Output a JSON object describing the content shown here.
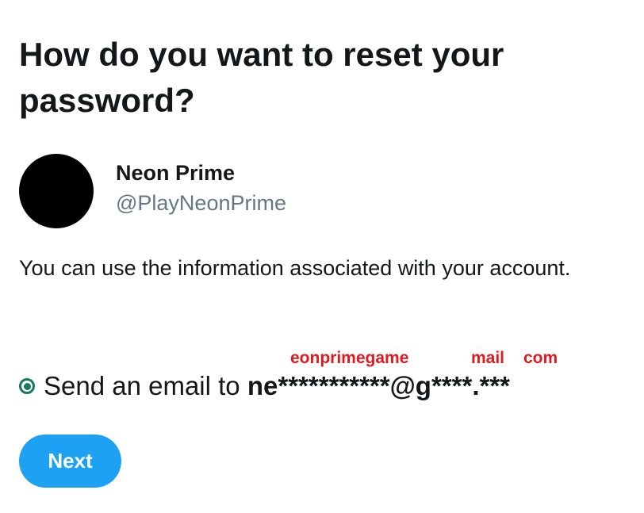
{
  "page": {
    "title": "How do you want to reset your password?"
  },
  "account": {
    "display_name": "Neon Prime",
    "handle": "@PlayNeonPrime"
  },
  "info_text": "You can use the information associated with your account.",
  "reset_option": {
    "label_prefix": "Send an email to ",
    "masked_email": "ne***********@g****.***",
    "selected": true
  },
  "annotations": {
    "local_part": "eonprimegame",
    "domain_part": "mail",
    "tld_part": "com"
  },
  "actions": {
    "next_label": "Next"
  },
  "colors": {
    "primary_text": "#14171a",
    "secondary_text": "#657786",
    "accent_button": "#1da1f2",
    "radio_selected": "#17795e",
    "annotation_red": "#e0191f"
  }
}
